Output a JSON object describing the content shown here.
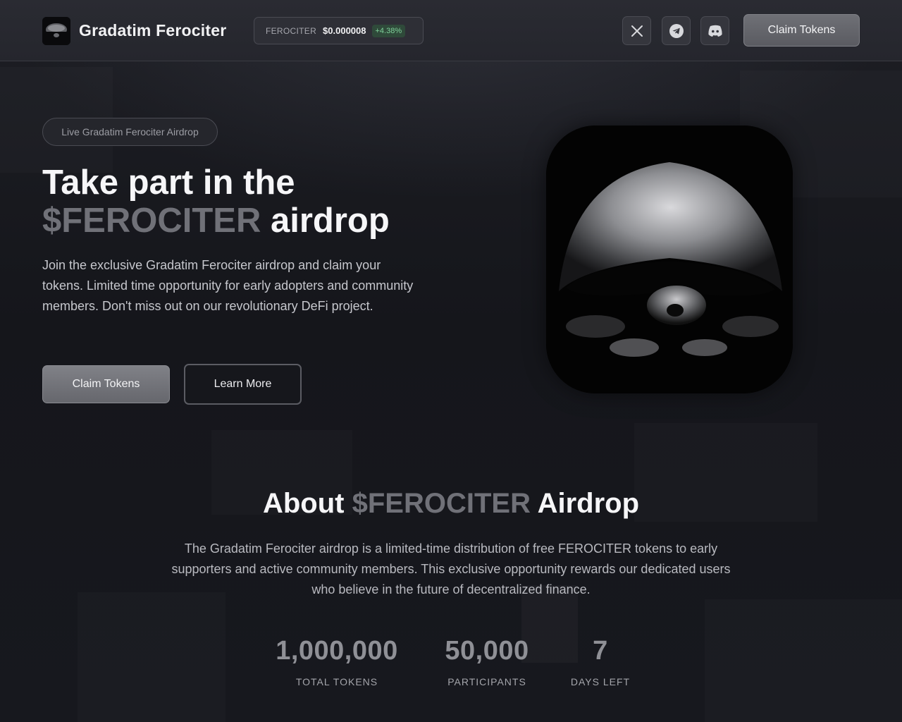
{
  "header": {
    "brand": "Gradatim Ferociter",
    "ticker": {
      "symbol": "FEROCITER",
      "price": "$0.000008",
      "change": "+4.38%"
    },
    "social": [
      {
        "icon": "x-icon"
      },
      {
        "icon": "telegram-icon"
      },
      {
        "icon": "discord-icon"
      }
    ],
    "claim_label": "Claim Tokens"
  },
  "hero": {
    "badge": "Live Gradatim Ferociter Airdrop",
    "title_line1": "Take part in the",
    "title_accent": "$FEROCITER",
    "title_end": "airdrop",
    "description": "Join the exclusive Gradatim Ferociter airdrop and claim your tokens. Limited time opportunity for early adopters and community members. Don't miss out on our revolutionary DeFi project.",
    "claim_label": "Claim Tokens",
    "learn_label": "Learn More"
  },
  "about": {
    "title_start": "About",
    "title_accent": "$FEROCITER",
    "title_end": "Airdrop",
    "description": "The Gradatim Ferociter airdrop is a limited-time distribution of free FEROCITER tokens to early supporters and active community members. This exclusive opportunity rewards our dedicated users who believe in the future of decentralized finance.",
    "stats": [
      {
        "value": "1,000,000",
        "label": "TOTAL TOKENS"
      },
      {
        "value": "50,000",
        "label": "PARTICIPANTS"
      },
      {
        "value": "7",
        "label": "DAYS LEFT"
      }
    ]
  },
  "colors": {
    "background": "#16171c",
    "header": "#2a2b32",
    "accent_text": "#707178",
    "positive": "#7fd19a"
  }
}
